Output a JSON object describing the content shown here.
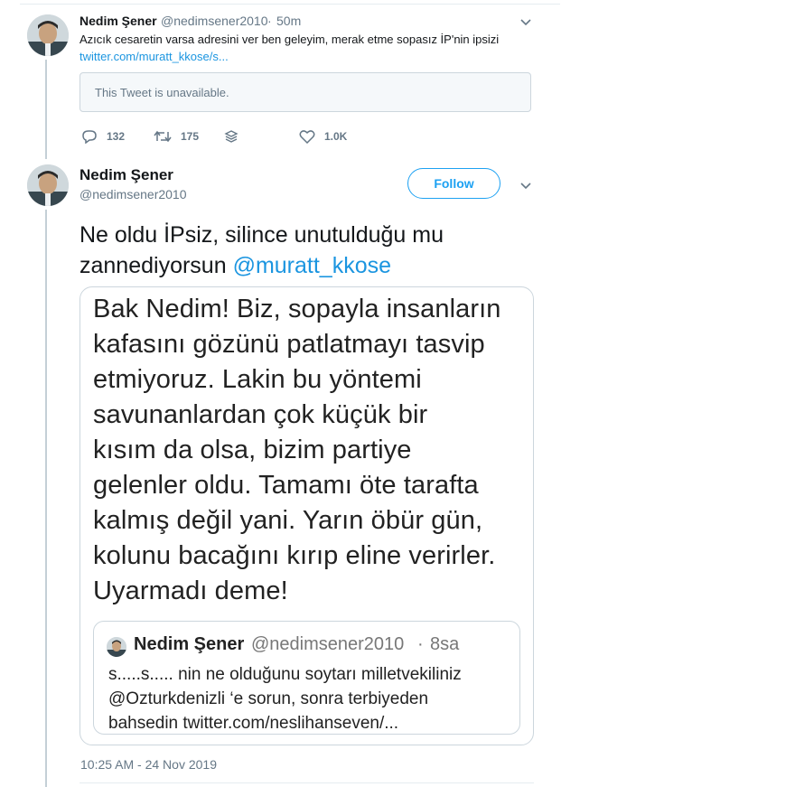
{
  "tweet1": {
    "author_name": "Nedim Şener",
    "handle": "@nedimsener2010",
    "separator": "·",
    "time": "50m",
    "text": "Azıcık cesaretin varsa adresini ver ben geleyim, merak etme sopasız İP'nin ipsizi",
    "link": "twitter.com/muratt_kkose/s...",
    "unavailable_text": "This Tweet is unavailable.",
    "actions": {
      "reply_count": "132",
      "retweet_count": "175",
      "like_count": "1.0K"
    }
  },
  "tweet2": {
    "author_name": "Nedim Şener",
    "handle": "@nedimsener2010",
    "follow_label": "Follow",
    "text_line1": "Ne oldu İPsiz, silince unutulduğu mu",
    "text_line2_prefix": "zannediyorsun ",
    "mention": "@muratt_kkose",
    "media_lines": [
      "Bak Nedim! Biz, sopayla insanların",
      "kafasını gözünü patlatmayı tasvip",
      "etmiyoruz. Lakin bu yöntemi",
      "savunanlardan çok küçük bir",
      "kısım da olsa, bizim partiye",
      "gelenler oldu. Tamamı öte tarafta",
      "kalmış değil yani. Yarın öbür gün,",
      "kolunu bacağını kırıp eline verirler.",
      "Uyarmadı deme!"
    ],
    "quoted": {
      "author_name": "Nedim Şener",
      "handle": "@nedimsener2010",
      "separator": "·",
      "time": "8sa",
      "lines": [
        "s.....s..... nin ne olduğunu soytarı milletvekiliniz",
        "@Ozturkdenizli ‘e sorun, sonra terbiyeden",
        "bahsedin twitter.com/neslihanseven/..."
      ]
    },
    "timestamp": "10:25 AM - 24 Nov 2019"
  },
  "colors": {
    "link_blue": "#1b95e0",
    "follow_blue": "#1da1f2",
    "muted_gray": "#657786",
    "thread_line": "#c4cfd6"
  },
  "icons": [
    "reply-icon",
    "retweet-icon",
    "stack-icon",
    "like-icon",
    "chevron-down-icon"
  ]
}
